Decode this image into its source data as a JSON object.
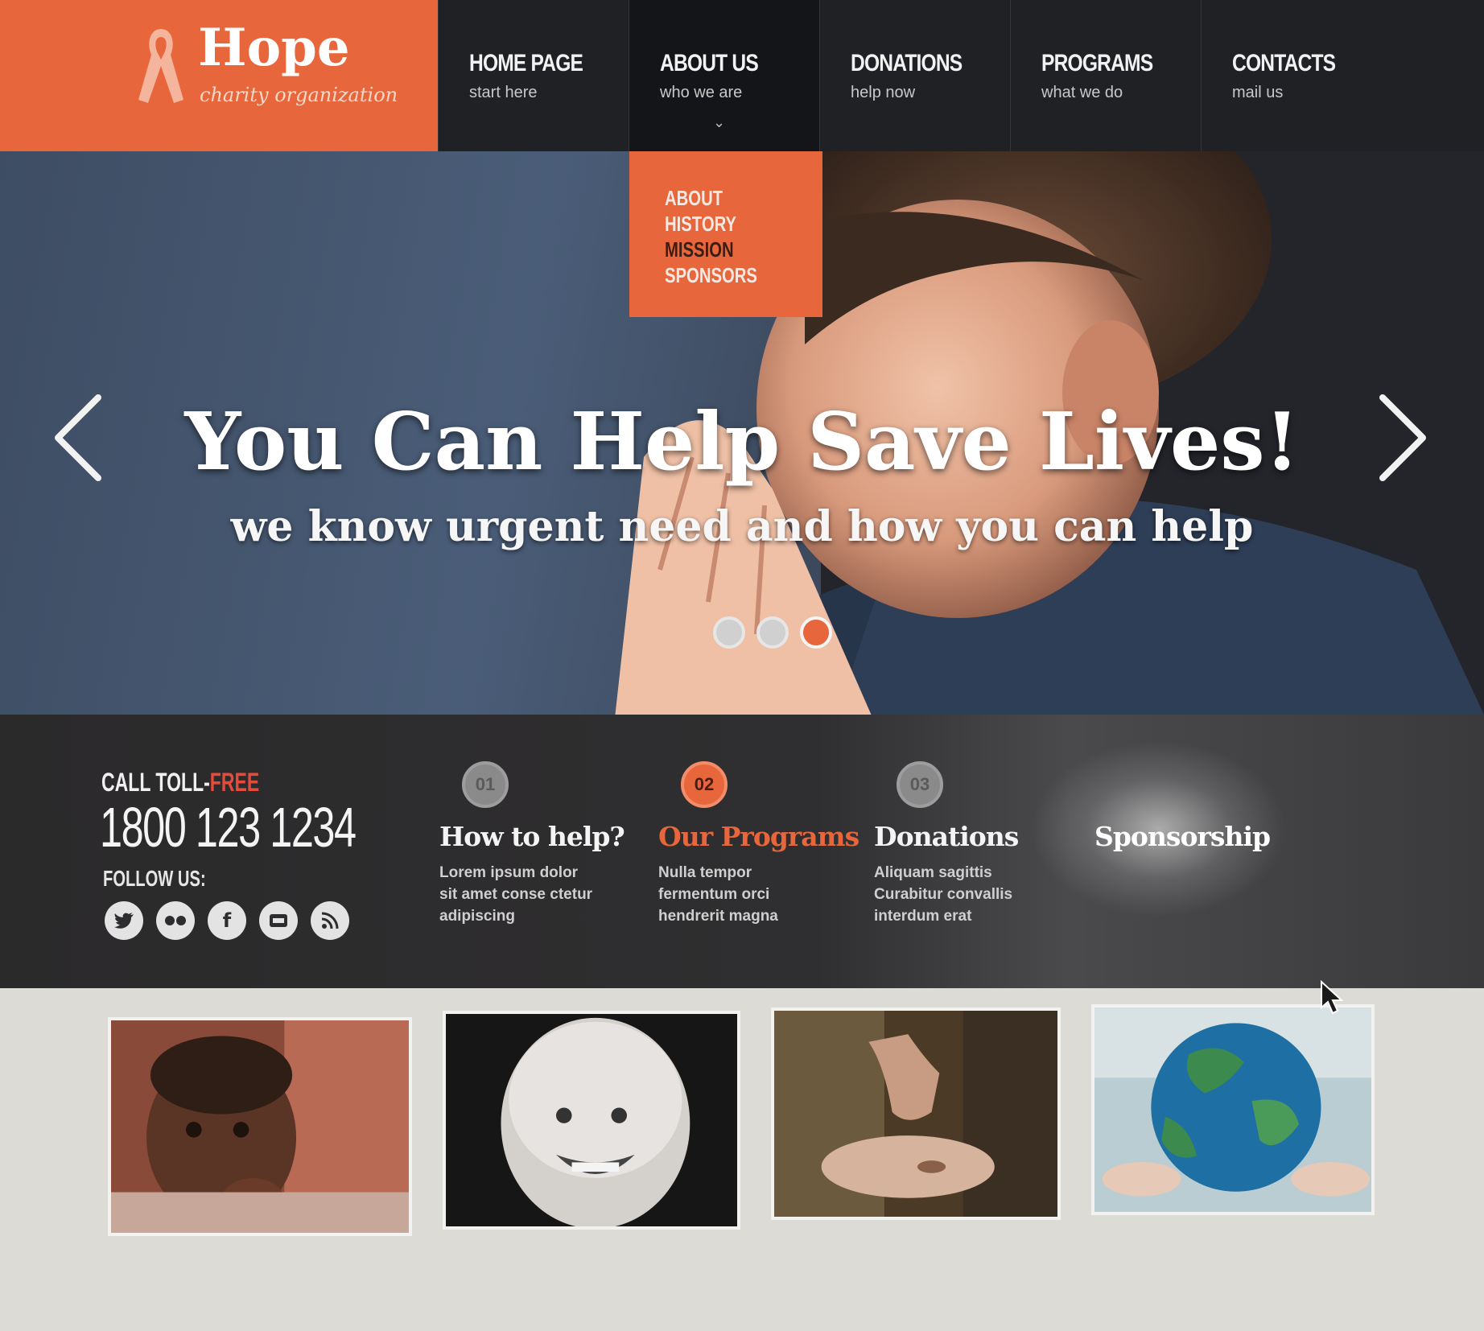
{
  "logo": {
    "title": "Hope",
    "subtitle": "charity organization"
  },
  "nav": [
    {
      "label": "HOME PAGE",
      "sub": "start here"
    },
    {
      "label": "ABOUT US",
      "sub": "who we are"
    },
    {
      "label": "DONATIONS",
      "sub": "help now"
    },
    {
      "label": "PROGRAMS",
      "sub": "what we do"
    },
    {
      "label": "CONTACTS",
      "sub": "mail us"
    }
  ],
  "dropdown": [
    "ABOUT",
    "HISTORY",
    "MISSION",
    "SPONSORS"
  ],
  "hero": {
    "title": "You Can Help Save Lives!",
    "subtitle": "we know urgent need and how you can help",
    "active_slide": 3,
    "slide_count": 3
  },
  "contact": {
    "call_label": "CALL TOLL-",
    "call_free": "FREE",
    "phone": "1800 123 1234",
    "follow_label": "FOLLOW US:",
    "socials": [
      "twitter-icon",
      "flickr-icon",
      "facebook-icon",
      "youtube-icon",
      "rss-icon"
    ]
  },
  "features": [
    {
      "num": "01",
      "title": "How to help?",
      "text": "Lorem ipsum dolor\nsit amet conse ctetur\nadipiscing"
    },
    {
      "num": "02",
      "title": "Our Programs",
      "text": "Nulla tempor\nfermentum orci\nhendrerit magna"
    },
    {
      "num": "03",
      "title": "Donations",
      "text": "Aliquam sagittis\nCurabitur convallis\ninterdum erat"
    },
    {
      "num": "",
      "title": "Sponsorship",
      "text": ""
    }
  ],
  "colors": {
    "accent": "#e8663c",
    "nav_bg": "#202125",
    "info_bg": "#2b2a2b"
  }
}
